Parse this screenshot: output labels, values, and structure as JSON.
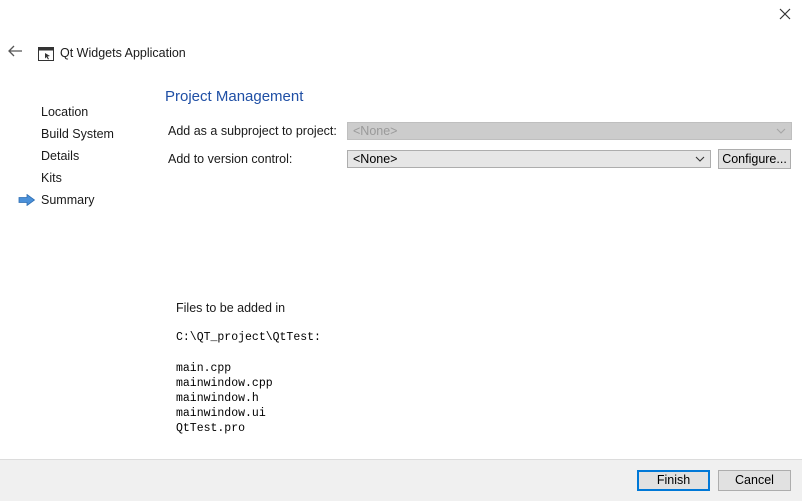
{
  "window": {
    "title": "Qt Widgets Application",
    "close_icon": "close-icon",
    "back_icon": "back-arrow-icon",
    "app_icon": "qt-app-window-icon"
  },
  "sidebar": {
    "items": [
      {
        "label": "Location",
        "active": false
      },
      {
        "label": "Build System",
        "active": false
      },
      {
        "label": "Details",
        "active": false
      },
      {
        "label": "Kits",
        "active": false
      },
      {
        "label": "Summary",
        "active": true
      }
    ],
    "active_indicator_icon": "right-arrow-icon",
    "active_indicator_color": "#4a90d9"
  },
  "main": {
    "section_title": "Project Management",
    "section_title_color": "#1f4fa5",
    "subproject": {
      "label": "Add as a subproject to project:",
      "value": "<None>",
      "disabled": true
    },
    "version_control": {
      "label": "Add to version control:",
      "value": "<None>",
      "configure_label": "Configure..."
    },
    "files": {
      "heading": "Files to be added in",
      "path": "C:\\QT_project\\QtTest:",
      "list": [
        "main.cpp",
        "mainwindow.cpp",
        "mainwindow.h",
        "mainwindow.ui",
        "QtTest.pro"
      ]
    }
  },
  "footer": {
    "finish_label": "Finish",
    "cancel_label": "Cancel"
  }
}
